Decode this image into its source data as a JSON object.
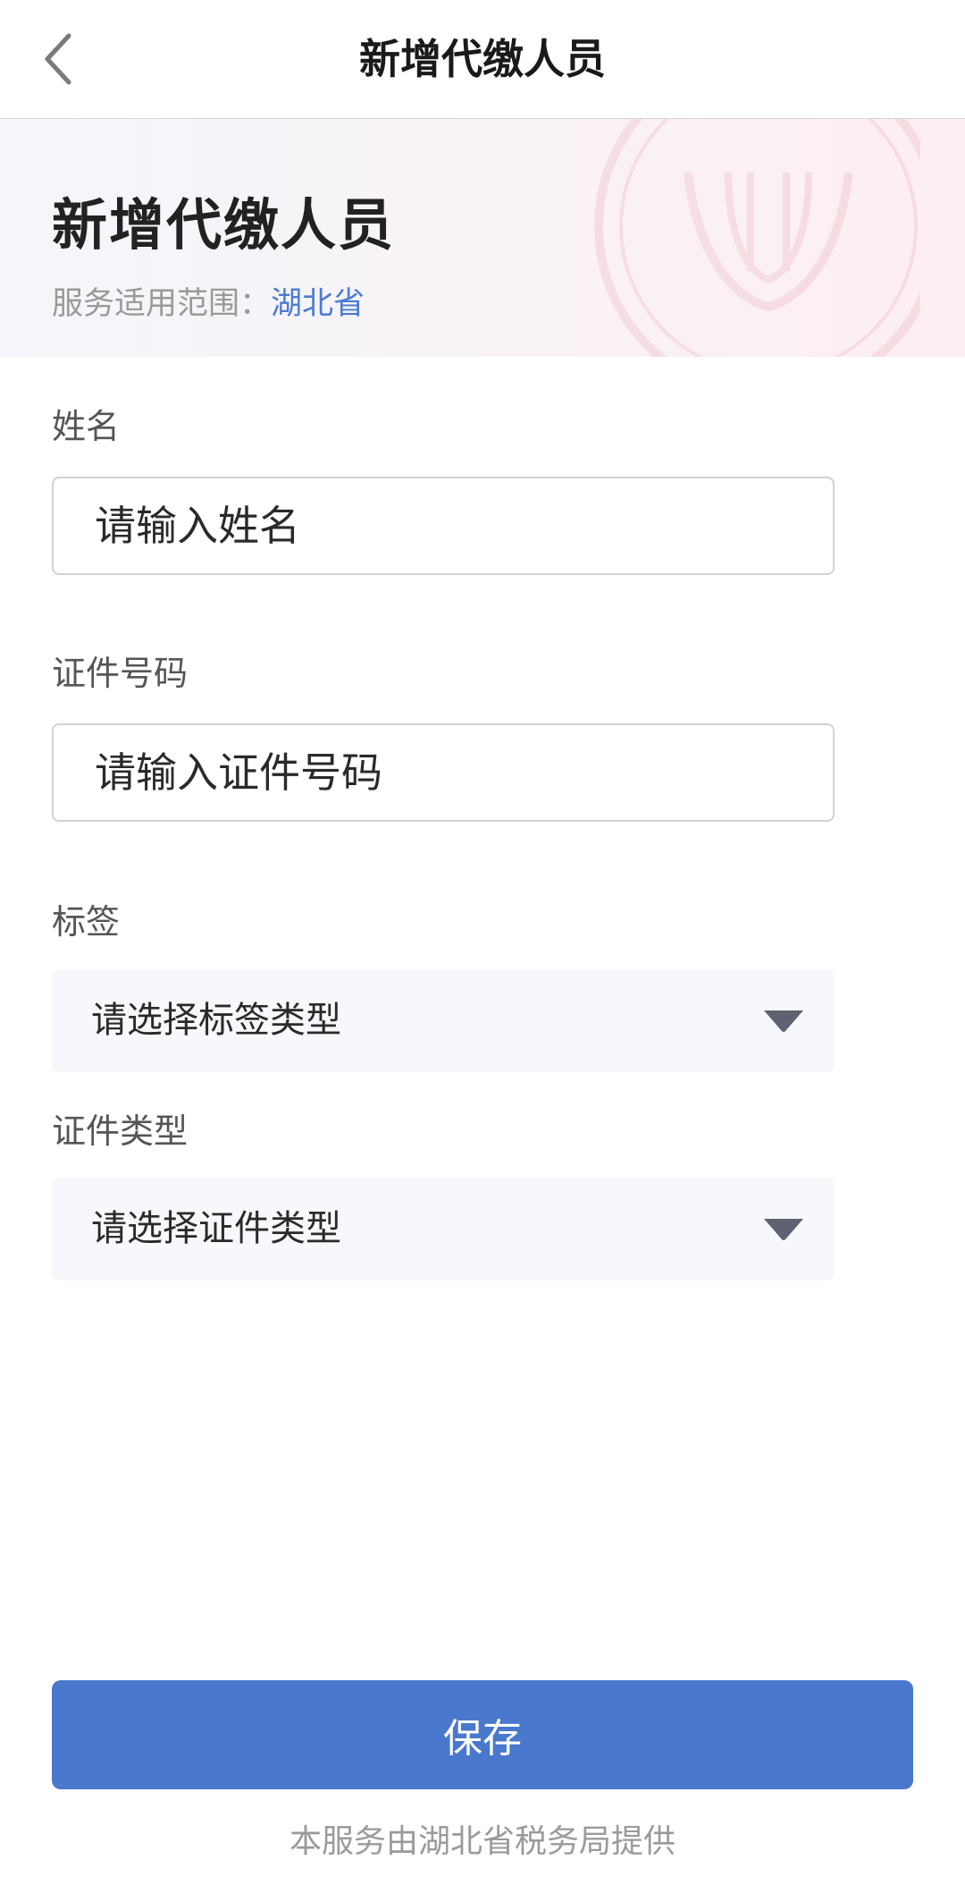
{
  "nav": {
    "title": "新增代缴人员",
    "back_icon": "chevron-left-icon"
  },
  "header": {
    "heading": "新增代缴人员",
    "scope_label": "服务适用范围：",
    "scope_value": "湖北省"
  },
  "form": {
    "name": {
      "label": "姓名",
      "placeholder": "请输入姓名",
      "value": ""
    },
    "id_number": {
      "label": "证件号码",
      "placeholder": "请输入证件号码",
      "value": ""
    },
    "tag": {
      "label": "标签",
      "selected": "请选择标签类型",
      "icon": "caret-down-icon"
    },
    "id_type": {
      "label": "证件类型",
      "selected": "请选择证件类型",
      "icon": "caret-down-icon"
    }
  },
  "actions": {
    "save_label": "保存"
  },
  "footer": {
    "note": "本服务由湖北省税务局提供"
  },
  "colors": {
    "accent": "#4a78cc",
    "scope_value": "#4b7bd3",
    "muted_text": "#9a9a9a"
  }
}
